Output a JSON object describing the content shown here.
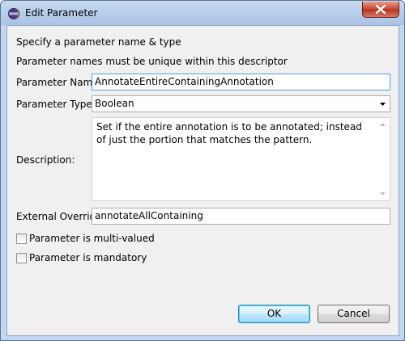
{
  "window": {
    "title": "Edit Parameter",
    "icon": "eclipse-icon"
  },
  "intro": {
    "line1": "Specify a parameter name & type",
    "line2": "Parameter names must be unique within this descriptor"
  },
  "form": {
    "name_label": "Parameter Name",
    "name_value": "AnnotateEntireContainingAnnotation",
    "type_label": "Parameter Type",
    "type_value": "Boolean",
    "description_label": "Description:",
    "description_value": "Set if the entire annotation is to be annotated; instead of just the portion that matches the pattern.",
    "override_label": "External Override",
    "override_value": "annotateAllContaining",
    "multivalued_label": "Parameter is multi-valued",
    "multivalued_checked": false,
    "mandatory_label": "Parameter is mandatory",
    "mandatory_checked": false
  },
  "buttons": {
    "ok": "OK",
    "cancel": "Cancel"
  }
}
